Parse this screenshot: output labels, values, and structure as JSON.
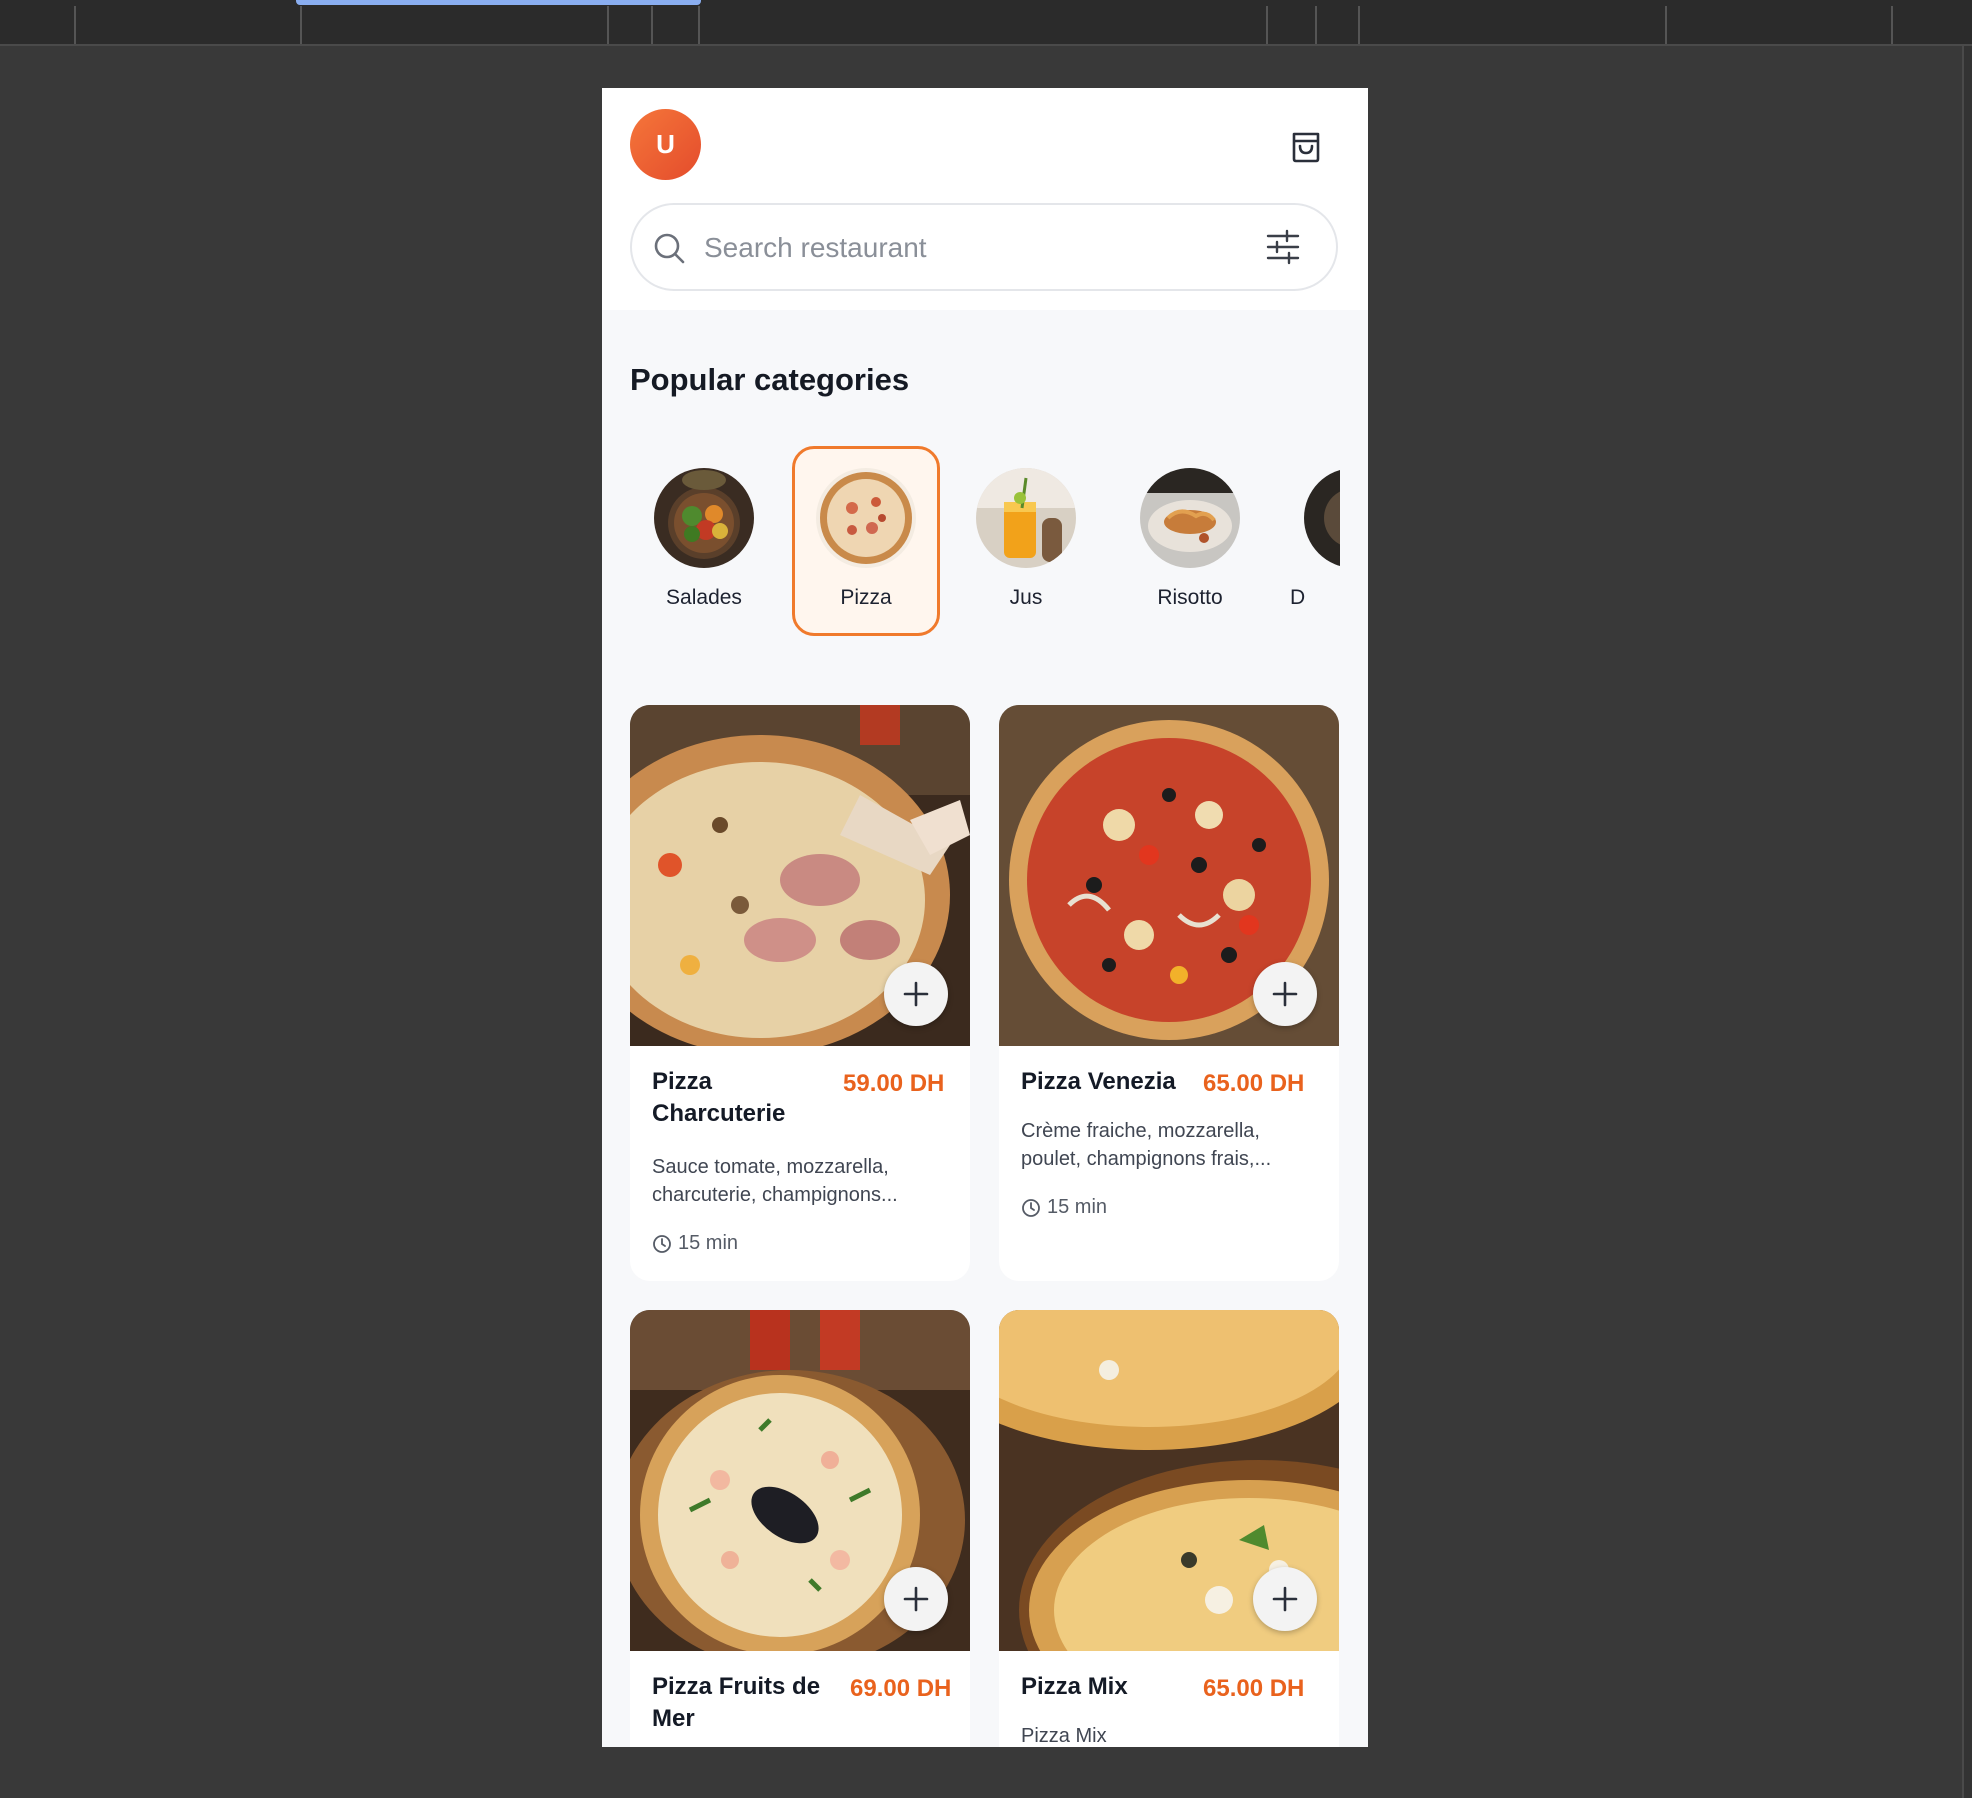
{
  "header": {
    "avatar_initial": "U",
    "cart_icon": "shopping-bag-icon",
    "search": {
      "placeholder": "Search restaurant",
      "value": ""
    }
  },
  "categories": {
    "title": "Popular categories",
    "items": [
      {
        "label": "Salades",
        "active": false
      },
      {
        "label": "Pizza",
        "active": true
      },
      {
        "label": "Jus",
        "active": false
      },
      {
        "label": "Risotto",
        "active": false
      },
      {
        "label": "D",
        "active": false
      }
    ]
  },
  "products": [
    {
      "name": "Pizza Charcuterie",
      "price": "59.00 DH",
      "description": "Sauce tomate, mozzarella, charcuterie, champignons...",
      "time": "15 min"
    },
    {
      "name": "Pizza Venezia",
      "price": "65.00 DH",
      "description": "Crème fraiche, mozzarella, poulet, champignons frais,...",
      "time": "15 min"
    },
    {
      "name": "Pizza Fruits de Mer",
      "price": "69.00 DH",
      "description": "",
      "time": ""
    },
    {
      "name": "Pizza Mix",
      "price": "65.00 DH",
      "description": "Pizza Mix",
      "time": ""
    }
  ],
  "colors": {
    "accent": "#f07a2c",
    "price": "#e9621d",
    "avatar_gradient_start": "#f5763a",
    "avatar_gradient_end": "#e44c2c",
    "page_background": "#393939"
  }
}
